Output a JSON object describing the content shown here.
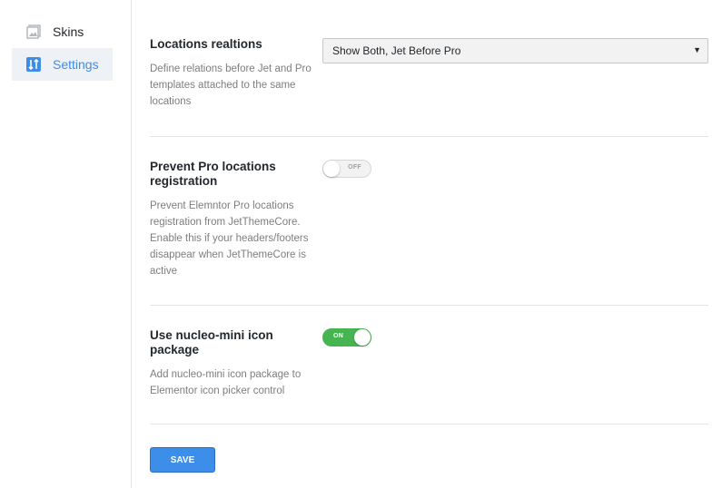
{
  "sidebar": {
    "items": [
      {
        "label": "Skins",
        "icon": "skins-icon",
        "active": false
      },
      {
        "label": "Settings",
        "icon": "settings-sliders-icon",
        "active": true
      }
    ]
  },
  "settings": {
    "locations_relations": {
      "title": "Locations realtions",
      "description": "Define relations before Jet and Pro templates attached to the same locations",
      "selected_value": "Show Both, Jet Before Pro"
    },
    "prevent_pro_locations": {
      "title": "Prevent Pro locations registration",
      "description": "Prevent Elemntor Pro locations registration from JetThemeCore. Enable this if your headers/footers disappear when JetThemeCore is active",
      "state": "OFF"
    },
    "nucleo_mini": {
      "title": "Use nucleo-mini icon package",
      "description": "Add nucleo-mini icon package to Elementor icon picker control",
      "state": "ON"
    }
  },
  "actions": {
    "save_label": "SAVE"
  },
  "colors": {
    "accent": "#3d8ee8",
    "toggle_on": "#46b450",
    "active_nav_bg": "#eef1f6"
  }
}
